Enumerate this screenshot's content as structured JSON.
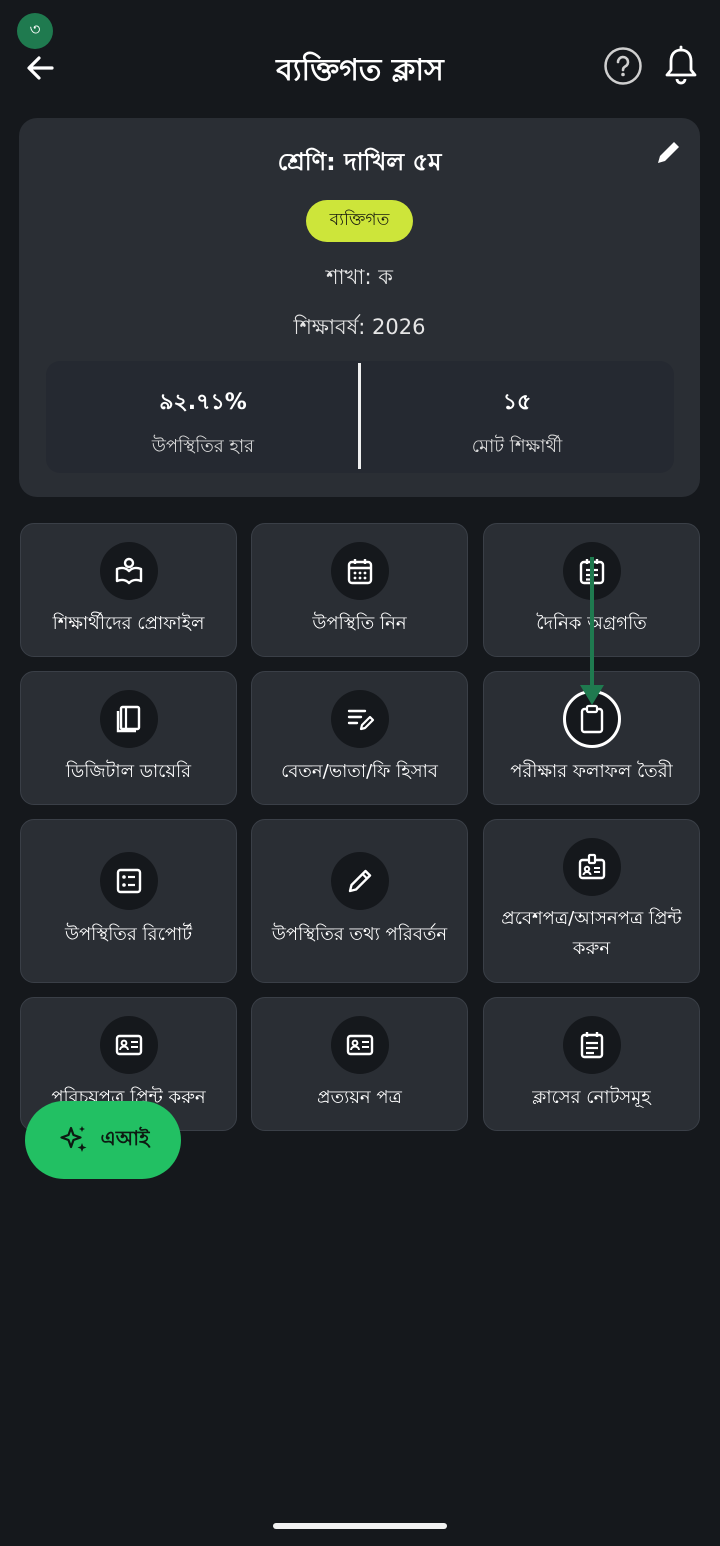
{
  "step_badge": "৩",
  "header": {
    "title": "ব্যক্তিগত ক্লাস"
  },
  "class_card": {
    "class_name": "শ্রেণি: দাখিল ৫ম",
    "type_badge": "ব্যক্তিগত",
    "section": "শাখা: ক",
    "session": "শিক্ষাবর্ষ: 2026",
    "stats": {
      "attendance_value": "৯২.৭১%",
      "attendance_label": "উপস্থিতির হার",
      "students_value": "১৫",
      "students_label": "মোট শিক্ষার্থী"
    }
  },
  "tiles": [
    {
      "label": "শিক্ষার্থীদের প্রোফাইল",
      "icon": "student-reading-icon"
    },
    {
      "label": "উপস্থিতি নিন",
      "icon": "calendar-icon"
    },
    {
      "label": "দৈনিক অগ্রগতি",
      "icon": "calendar-notes-icon"
    },
    {
      "label": "ডিজিটাল ডায়েরি",
      "icon": "book-icon"
    },
    {
      "label": "বেতন/ভাতা/ফি হিসাব",
      "icon": "edit-note-icon"
    },
    {
      "label": "পরীক্ষার ফলাফল তৈরী",
      "icon": "clipboard-icon"
    },
    {
      "label": "উপস্থিতির রিপোর্ট",
      "icon": "list-report-icon"
    },
    {
      "label": "উপস্থিতির তথ্য পরিবর্তন",
      "icon": "pencil-icon"
    },
    {
      "label": "প্রবেশপত্র/আসনপত্র প্রিন্ট করুন",
      "icon": "badge-icon"
    },
    {
      "label": "পরিচয়পত্র প্রিন্ট করুন",
      "icon": "id-card-icon"
    },
    {
      "label": "প্রত্যয়ন পত্র",
      "icon": "certificate-icon"
    },
    {
      "label": "ক্লাসের নোটসমূহ",
      "icon": "notes-icon"
    }
  ],
  "ai_button": {
    "label": "এআই",
    "icon": "sparkle-icon"
  },
  "colors": {
    "background": "#15181c",
    "card": "#2a2e34",
    "badge": "#cde53a",
    "fab": "#22c063",
    "annotation_arrow": "#1f7a4f"
  }
}
